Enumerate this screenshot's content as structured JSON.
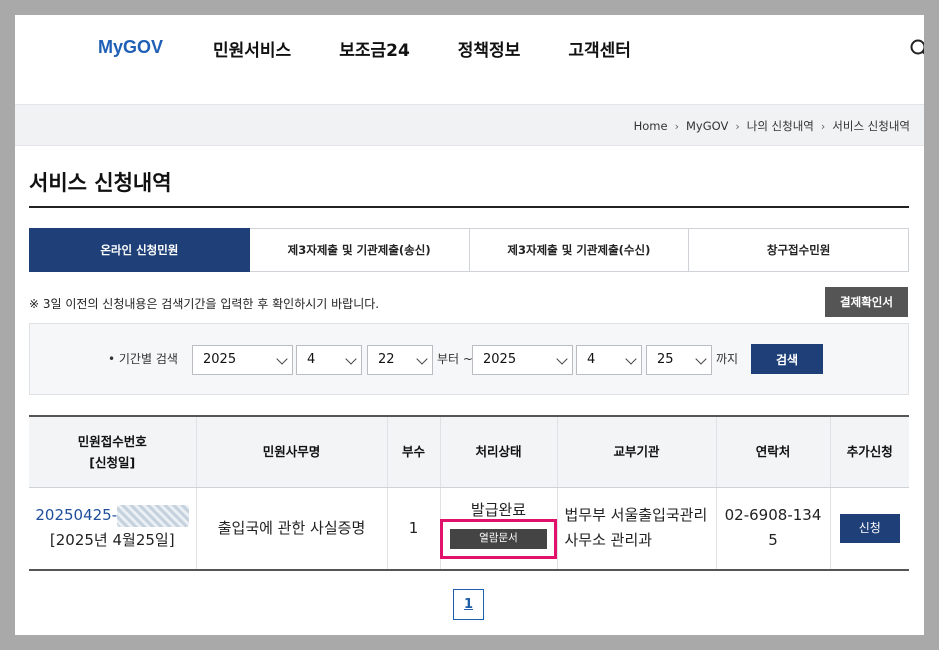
{
  "header": {
    "logo": "MyGOV",
    "nav": [
      "민원서비스",
      "보조금24",
      "정책정보",
      "고객센터"
    ],
    "search_icon": "search-icon"
  },
  "breadcrumb": [
    "Home",
    "MyGOV",
    "나의 신청내역",
    "서비스 신청내역"
  ],
  "page_title": "서비스 신청내역",
  "tabs": [
    {
      "label": "온라인 신청민원",
      "active": true
    },
    {
      "label": "제3자제출 및 기관제출(송신)",
      "active": false
    },
    {
      "label": "제3자제출 및 기관제출(수신)",
      "active": false
    },
    {
      "label": "창구접수민원",
      "active": false
    }
  ],
  "notice": "※ 3일 이전의 신청내용은 검색기간을 입력한 후 확인하시기 바랍니다.",
  "payment_button": "결제확인서",
  "search": {
    "label": "• 기간별 검색",
    "from_year": "2025",
    "from_month": "4",
    "from_day": "22",
    "from_text": "부터 ~",
    "to_year": "2025",
    "to_month": "4",
    "to_day": "25",
    "to_text": "까지",
    "button": "검색"
  },
  "table": {
    "headers": [
      "민원접수번호",
      "[신청일]",
      "민원사무명",
      "부수",
      "처리상태",
      "교부기관",
      "연락처",
      "추가신청"
    ],
    "rows": [
      {
        "receipt_no": "20250425-",
        "date": "[2025년 4월25일]",
        "name": "출입국에 관한 사실증명",
        "copies": "1",
        "status": "발급완료",
        "view_button": "열람문서",
        "agency_line1": "법무부 서울출입국관리",
        "agency_line2": "사무소 관리과",
        "phone_line1": "02-6908-134",
        "phone_line2": "5",
        "apply_button": "신청"
      }
    ]
  },
  "pagination": {
    "current": "1"
  }
}
